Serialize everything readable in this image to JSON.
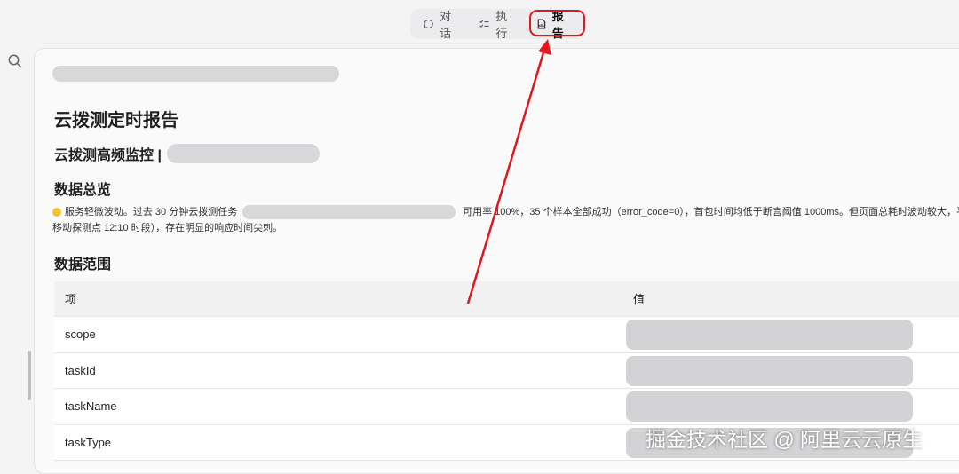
{
  "tabs": [
    {
      "label": "对话",
      "icon": "chat-bubble-icon"
    },
    {
      "label": "执行",
      "icon": "checklist-icon"
    },
    {
      "label": "报告",
      "icon": "report-icon",
      "active": true
    }
  ],
  "report": {
    "title": "云拨测定时报告",
    "monitor_title": "云拨测高频监控 |"
  },
  "overview": {
    "heading": "数据总览",
    "summary_part1": "服务轻微波动。过去 30 分钟云拨测任务",
    "summary_part2": "可用率 100%，35 个样本全部成功（error_code=0），首包时间均低于断言阈值 1000ms。但页面总耗时波动较大，平均",
    "summary_line2": "移动探测点 12:10 时段），存在明显的响应时间尖刺。"
  },
  "data_range": {
    "heading": "数据范围",
    "columns": [
      "项",
      "值"
    ],
    "rows": [
      {
        "key": "scope"
      },
      {
        "key": "taskId"
      },
      {
        "key": "taskName"
      },
      {
        "key": "taskType"
      }
    ]
  },
  "watermark": "掘金技术社区 @ 阿里云云原生",
  "colors": {
    "annotation_red": "#e0181c",
    "status_yellow": "#f2c230"
  }
}
